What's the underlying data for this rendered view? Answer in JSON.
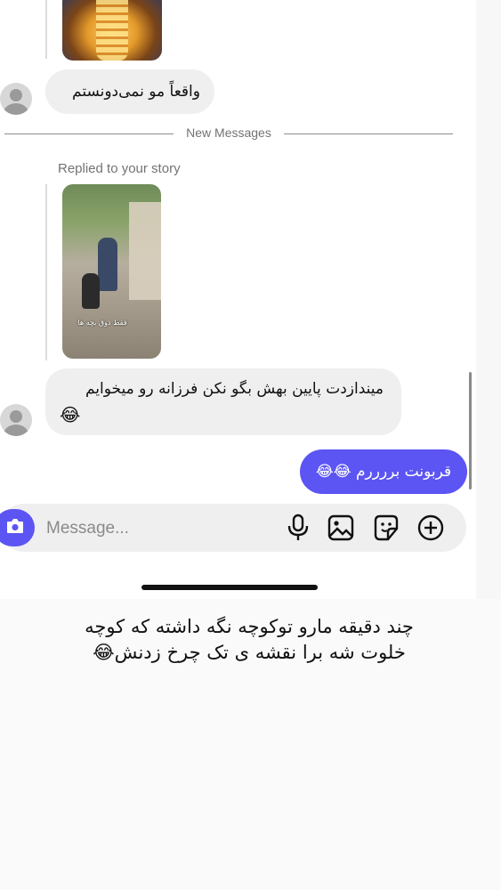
{
  "messages": {
    "top_in": {
      "text": "واقعاً مو نمی‌دونستم"
    },
    "divider": {
      "label": "New Messages"
    },
    "story_reply": {
      "label": "Replied to your story",
      "story_caption": "فقط ذوق بچه ها"
    },
    "second_in": {
      "line1": "میندازدت پایین بهش بگو نکن فرزانه رو میخوایم",
      "line2": "😂"
    },
    "out": {
      "text": "قربونت بررررم 😂😂"
    }
  },
  "composer": {
    "placeholder": "Message...",
    "icons": [
      "camera-icon",
      "microphone-icon",
      "gallery-icon",
      "sticker-icon",
      "plus-icon"
    ]
  },
  "caption": {
    "line1": "چند دقیقه مارو توکوچه نگه داشته که کوچه",
    "line2": "خلوت شه برا نقشه ی  تک چرخ زدنش😂"
  },
  "colors": {
    "accent": "#5c55f3",
    "incoming_bubble": "#efefef",
    "muted_text": "#737373"
  }
}
